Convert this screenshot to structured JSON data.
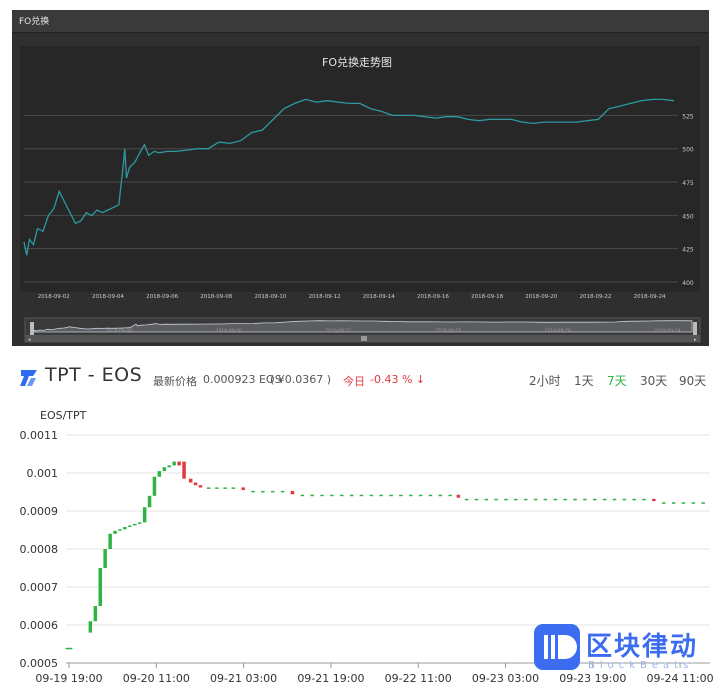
{
  "top_panel": {
    "header_label": "FO兑换",
    "chart_title": "FO兑换走势图"
  },
  "bottom_panel": {
    "pair": "TPT - EOS",
    "price_label": "最新价格",
    "price_value": "0.000923 EOS",
    "price_cny": "( ¥0.0367 )",
    "change_label": "今日",
    "change_value": "-0.43 % ↓",
    "timeframes": [
      {
        "label": "2小时",
        "active": false
      },
      {
        "label": "1天",
        "active": false
      },
      {
        "label": "7天",
        "active": true
      },
      {
        "label": "30天",
        "active": false
      },
      {
        "label": "90天",
        "active": false
      }
    ]
  },
  "watermark": {
    "text": "区块律动",
    "sub": "BlockBeats"
  },
  "colors": {
    "top_line": "#2c9aa0",
    "up": "#2fb344",
    "down": "#e0393e"
  },
  "chart_data": [
    {
      "type": "line",
      "title": "FO兑换走势图",
      "x": [
        "2018-09-02",
        "2018-09-04",
        "2018-09-06",
        "2018-09-08",
        "2018-09-10",
        "2018-09-12",
        "2018-09-14",
        "2018-09-16",
        "2018-09-18",
        "2018-09-20",
        "2018-09-22",
        "2018-09-24"
      ],
      "ylim": [
        400,
        550
      ],
      "y_ticks": [
        400,
        425,
        450,
        475,
        500,
        525
      ],
      "series": [
        {
          "points": [
            [
              0.0,
              430
            ],
            [
              0.1,
              420
            ],
            [
              0.2,
              432
            ],
            [
              0.35,
              428
            ],
            [
              0.5,
              440
            ],
            [
              0.7,
              438
            ],
            [
              0.9,
              450
            ],
            [
              1.1,
              455
            ],
            [
              1.3,
              468
            ],
            [
              1.5,
              460
            ],
            [
              1.7,
              452
            ],
            [
              1.9,
              444
            ],
            [
              2.1,
              446
            ],
            [
              2.3,
              452
            ],
            [
              2.5,
              450
            ],
            [
              2.7,
              454
            ],
            [
              2.9,
              452
            ],
            [
              3.1,
              454
            ],
            [
              3.3,
              456
            ],
            [
              3.5,
              458
            ],
            [
              3.65,
              485
            ],
            [
              3.72,
              500
            ],
            [
              3.78,
              478
            ],
            [
              3.9,
              486
            ],
            [
              4.1,
              490
            ],
            [
              4.3,
              498
            ],
            [
              4.45,
              503
            ],
            [
              4.6,
              495
            ],
            [
              4.8,
              498
            ],
            [
              5.0,
              497
            ],
            [
              5.3,
              498
            ],
            [
              5.6,
              498
            ],
            [
              6.0,
              499
            ],
            [
              6.4,
              500
            ],
            [
              6.8,
              500
            ],
            [
              7.2,
              505
            ],
            [
              7.6,
              504
            ],
            [
              8.0,
              506
            ],
            [
              8.4,
              512
            ],
            [
              8.8,
              514
            ],
            [
              9.2,
              522
            ],
            [
              9.6,
              530
            ],
            [
              10.0,
              534
            ],
            [
              10.4,
              537
            ],
            [
              10.8,
              535
            ],
            [
              11.2,
              536
            ],
            [
              11.6,
              535
            ],
            [
              12.0,
              534
            ],
            [
              12.4,
              534
            ],
            [
              12.8,
              530
            ],
            [
              13.2,
              528
            ],
            [
              13.6,
              525
            ],
            [
              14.0,
              525
            ],
            [
              14.4,
              525
            ],
            [
              14.8,
              524
            ],
            [
              15.2,
              523
            ],
            [
              15.6,
              524
            ],
            [
              16.0,
              524
            ],
            [
              16.4,
              522
            ],
            [
              16.8,
              521
            ],
            [
              17.2,
              522
            ],
            [
              17.6,
              522
            ],
            [
              18.0,
              522
            ],
            [
              18.4,
              520
            ],
            [
              18.8,
              519
            ],
            [
              19.2,
              520
            ],
            [
              19.6,
              520
            ],
            [
              20.0,
              520
            ],
            [
              20.4,
              520
            ],
            [
              20.8,
              521
            ],
            [
              21.2,
              522
            ],
            [
              21.6,
              530
            ],
            [
              22.0,
              532
            ],
            [
              22.4,
              534
            ],
            [
              22.8,
              536
            ],
            [
              23.2,
              537
            ],
            [
              23.6,
              537
            ],
            [
              24.0,
              536
            ]
          ]
        }
      ]
    },
    {
      "type": "candlestick",
      "ylabel": "EOS/TPT",
      "ylim": [
        0.0005,
        0.0011
      ],
      "y_ticks": [
        "0.0005",
        "0.0006",
        "0.0007",
        "0.0008",
        "0.0009",
        "0.001",
        "0.0011"
      ],
      "x_ticks": [
        "09-19 19:00",
        "09-20 11:00",
        "09-21 03:00",
        "09-21 19:00",
        "09-22 11:00",
        "09-23 03:00",
        "09-23 19:00",
        "09-24 11:00"
      ],
      "candles": [
        {
          "t": 0.05,
          "o": 0.00054,
          "c": 0.00054
        },
        {
          "t": 0.15,
          "o": 0.00054,
          "c": 0.00054
        },
        {
          "t": 0.75,
          "o": 0.00058,
          "c": 0.00061
        },
        {
          "t": 0.9,
          "o": 0.00061,
          "c": 0.00065
        },
        {
          "t": 1.05,
          "o": 0.00065,
          "c": 0.00075
        },
        {
          "t": 1.2,
          "o": 0.00075,
          "c": 0.0008
        },
        {
          "t": 1.35,
          "o": 0.0008,
          "c": 0.00084
        },
        {
          "t": 1.5,
          "o": 0.00084,
          "c": 0.000848
        },
        {
          "t": 1.65,
          "o": 0.000848,
          "c": 0.000852
        },
        {
          "t": 1.8,
          "o": 0.000852,
          "c": 0.000858
        },
        {
          "t": 1.95,
          "o": 0.000858,
          "c": 0.000862
        },
        {
          "t": 2.1,
          "o": 0.000862,
          "c": 0.000866
        },
        {
          "t": 2.25,
          "o": 0.000866,
          "c": 0.00087
        },
        {
          "t": 2.4,
          "o": 0.00087,
          "c": 0.00091
        },
        {
          "t": 2.55,
          "o": 0.00091,
          "c": 0.00094
        },
        {
          "t": 2.7,
          "o": 0.00094,
          "c": 0.00099
        },
        {
          "t": 2.85,
          "o": 0.00099,
          "c": 0.001005
        },
        {
          "t": 3.0,
          "o": 0.001005,
          "c": 0.001015
        },
        {
          "t": 3.15,
          "o": 0.001015,
          "c": 0.00102
        },
        {
          "t": 3.3,
          "o": 0.00102,
          "c": 0.00103
        },
        {
          "t": 3.45,
          "o": 0.00103,
          "c": 0.00102
        },
        {
          "t": 3.6,
          "o": 0.00103,
          "c": 0.000985
        },
        {
          "t": 3.8,
          "o": 0.000985,
          "c": 0.000975
        },
        {
          "t": 3.95,
          "o": 0.000975,
          "c": 0.000968
        },
        {
          "t": 4.1,
          "o": 0.000968,
          "c": 0.000962
        },
        {
          "t": 4.35,
          "o": 0.000962,
          "c": 0.000962
        },
        {
          "t": 4.6,
          "o": 0.000962,
          "c": 0.000962
        },
        {
          "t": 4.85,
          "o": 0.000962,
          "c": 0.000962
        },
        {
          "t": 5.1,
          "o": 0.000962,
          "c": 0.000962
        },
        {
          "t": 5.4,
          "o": 0.000962,
          "c": 0.000955
        },
        {
          "t": 5.7,
          "o": 0.000953,
          "c": 0.000953
        },
        {
          "t": 6.0,
          "o": 0.000953,
          "c": 0.000953
        },
        {
          "t": 6.3,
          "o": 0.000953,
          "c": 0.000953
        },
        {
          "t": 6.6,
          "o": 0.000953,
          "c": 0.000953
        },
        {
          "t": 6.9,
          "o": 0.000953,
          "c": 0.000944
        },
        {
          "t": 7.2,
          "o": 0.000943,
          "c": 0.000943
        },
        {
          "t": 7.5,
          "o": 0.000943,
          "c": 0.000943
        },
        {
          "t": 7.8,
          "o": 0.000943,
          "c": 0.000943
        },
        {
          "t": 8.1,
          "o": 0.000943,
          "c": 0.000943
        },
        {
          "t": 8.4,
          "o": 0.000943,
          "c": 0.000943
        },
        {
          "t": 8.7,
          "o": 0.000943,
          "c": 0.000943
        },
        {
          "t": 9.0,
          "o": 0.000943,
          "c": 0.000943
        },
        {
          "t": 9.3,
          "o": 0.000943,
          "c": 0.000943
        },
        {
          "t": 9.6,
          "o": 0.000943,
          "c": 0.000943
        },
        {
          "t": 9.9,
          "o": 0.000943,
          "c": 0.000943
        },
        {
          "t": 10.2,
          "o": 0.000943,
          "c": 0.000943
        },
        {
          "t": 10.5,
          "o": 0.000943,
          "c": 0.000943
        },
        {
          "t": 10.8,
          "o": 0.000943,
          "c": 0.000943
        },
        {
          "t": 11.1,
          "o": 0.000943,
          "c": 0.000943
        },
        {
          "t": 11.4,
          "o": 0.000943,
          "c": 0.000943
        },
        {
          "t": 11.7,
          "o": 0.000943,
          "c": 0.000943
        },
        {
          "t": 11.95,
          "o": 0.000943,
          "c": 0.000935
        },
        {
          "t": 12.2,
          "o": 0.000932,
          "c": 0.000932
        },
        {
          "t": 12.5,
          "o": 0.000932,
          "c": 0.000932
        },
        {
          "t": 12.8,
          "o": 0.000932,
          "c": 0.000932
        },
        {
          "t": 13.1,
          "o": 0.000932,
          "c": 0.000932
        },
        {
          "t": 13.4,
          "o": 0.000932,
          "c": 0.000932
        },
        {
          "t": 13.7,
          "o": 0.000932,
          "c": 0.000932
        },
        {
          "t": 14.0,
          "o": 0.000932,
          "c": 0.000932
        },
        {
          "t": 14.3,
          "o": 0.000932,
          "c": 0.000932
        },
        {
          "t": 14.6,
          "o": 0.000932,
          "c": 0.000932
        },
        {
          "t": 14.9,
          "o": 0.000932,
          "c": 0.000932
        },
        {
          "t": 15.2,
          "o": 0.000932,
          "c": 0.000932
        },
        {
          "t": 15.5,
          "o": 0.000932,
          "c": 0.000932
        },
        {
          "t": 15.8,
          "o": 0.000932,
          "c": 0.000932
        },
        {
          "t": 16.1,
          "o": 0.000932,
          "c": 0.000932
        },
        {
          "t": 16.4,
          "o": 0.000932,
          "c": 0.000932
        },
        {
          "t": 16.7,
          "o": 0.000932,
          "c": 0.000932
        },
        {
          "t": 17.0,
          "o": 0.000932,
          "c": 0.000932
        },
        {
          "t": 17.3,
          "o": 0.000932,
          "c": 0.000932
        },
        {
          "t": 17.6,
          "o": 0.000932,
          "c": 0.000932
        },
        {
          "t": 17.9,
          "o": 0.000932,
          "c": 0.000926
        },
        {
          "t": 18.2,
          "o": 0.000923,
          "c": 0.000923
        },
        {
          "t": 18.5,
          "o": 0.000923,
          "c": 0.000923
        },
        {
          "t": 18.8,
          "o": 0.000923,
          "c": 0.000923
        },
        {
          "t": 19.1,
          "o": 0.000923,
          "c": 0.000923
        },
        {
          "t": 19.4,
          "o": 0.000923,
          "c": 0.000923
        }
      ]
    }
  ]
}
